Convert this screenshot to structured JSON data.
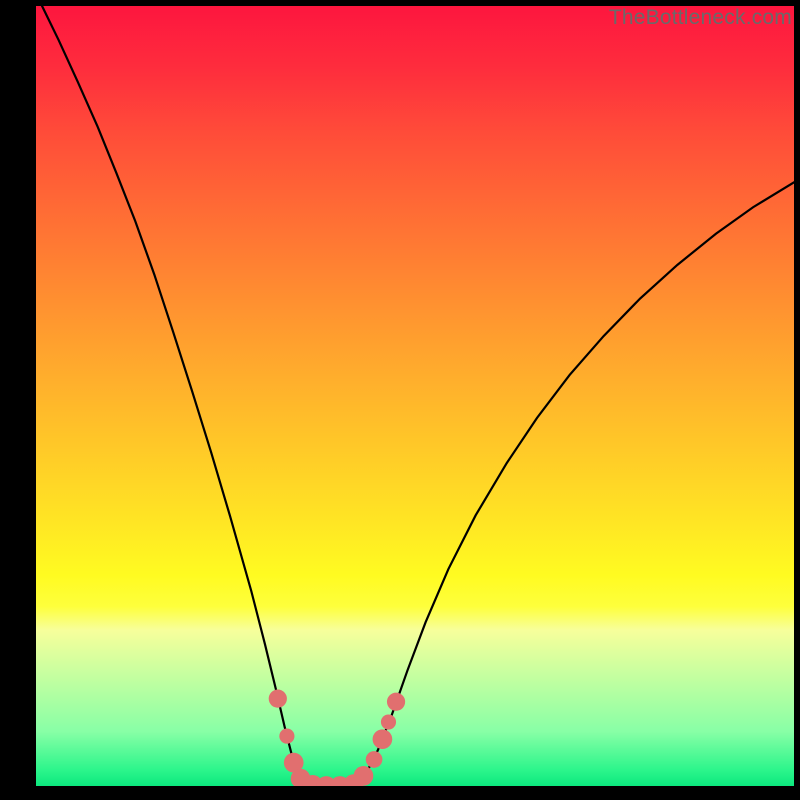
{
  "watermark": "TheBottleneck.com",
  "chart_data": {
    "type": "line",
    "title": "",
    "xlabel": "",
    "ylabel": "",
    "xlim": [
      0,
      100
    ],
    "ylim": [
      0,
      100
    ],
    "grid": false,
    "curve_points": [
      {
        "x": 0.8,
        "y": 100.0
      },
      {
        "x": 3.0,
        "y": 95.6
      },
      {
        "x": 5.5,
        "y": 90.3
      },
      {
        "x": 8.1,
        "y": 84.6
      },
      {
        "x": 10.6,
        "y": 78.6
      },
      {
        "x": 13.1,
        "y": 72.4
      },
      {
        "x": 15.6,
        "y": 65.6
      },
      {
        "x": 18.1,
        "y": 58.2
      },
      {
        "x": 20.6,
        "y": 50.6
      },
      {
        "x": 23.1,
        "y": 42.8
      },
      {
        "x": 25.6,
        "y": 34.6
      },
      {
        "x": 28.4,
        "y": 25.0
      },
      {
        "x": 30.2,
        "y": 18.2
      },
      {
        "x": 31.7,
        "y": 12.2
      },
      {
        "x": 32.8,
        "y": 7.6
      },
      {
        "x": 33.9,
        "y": 3.4
      },
      {
        "x": 35.2,
        "y": 0.8
      },
      {
        "x": 36.8,
        "y": 0.0
      },
      {
        "x": 38.5,
        "y": 0.0
      },
      {
        "x": 40.5,
        "y": 0.0
      },
      {
        "x": 42.3,
        "y": 0.4
      },
      {
        "x": 43.8,
        "y": 2.1
      },
      {
        "x": 45.1,
        "y": 4.6
      },
      {
        "x": 46.9,
        "y": 9.0
      },
      {
        "x": 49.0,
        "y": 14.8
      },
      {
        "x": 51.4,
        "y": 21.0
      },
      {
        "x": 54.4,
        "y": 27.8
      },
      {
        "x": 58.0,
        "y": 34.7
      },
      {
        "x": 62.1,
        "y": 41.4
      },
      {
        "x": 66.1,
        "y": 47.2
      },
      {
        "x": 70.4,
        "y": 52.7
      },
      {
        "x": 74.9,
        "y": 57.7
      },
      {
        "x": 79.7,
        "y": 62.5
      },
      {
        "x": 84.6,
        "y": 66.8
      },
      {
        "x": 89.7,
        "y": 70.8
      },
      {
        "x": 94.6,
        "y": 74.2
      },
      {
        "x": 100.0,
        "y": 77.4
      }
    ],
    "markers": [
      {
        "x": 31.9,
        "y": 11.2,
        "r": 1.2
      },
      {
        "x": 33.1,
        "y": 6.4,
        "r": 1.0
      },
      {
        "x": 34.0,
        "y": 3.0,
        "r": 1.3
      },
      {
        "x": 34.9,
        "y": 0.95,
        "r": 1.3
      },
      {
        "x": 36.5,
        "y": 0.15,
        "r": 1.3
      },
      {
        "x": 38.3,
        "y": 0.0,
        "r": 1.3
      },
      {
        "x": 40.1,
        "y": 0.0,
        "r": 1.3
      },
      {
        "x": 41.9,
        "y": 0.25,
        "r": 1.3
      },
      {
        "x": 43.2,
        "y": 1.3,
        "r": 1.3
      },
      {
        "x": 44.6,
        "y": 3.4,
        "r": 1.1
      },
      {
        "x": 45.7,
        "y": 6.0,
        "r": 1.3
      },
      {
        "x": 46.5,
        "y": 8.2,
        "r": 1.0
      },
      {
        "x": 47.5,
        "y": 10.8,
        "r": 1.2
      }
    ],
    "colors": {
      "curve": "#000000",
      "marker_fill": "#e16f6f"
    }
  }
}
